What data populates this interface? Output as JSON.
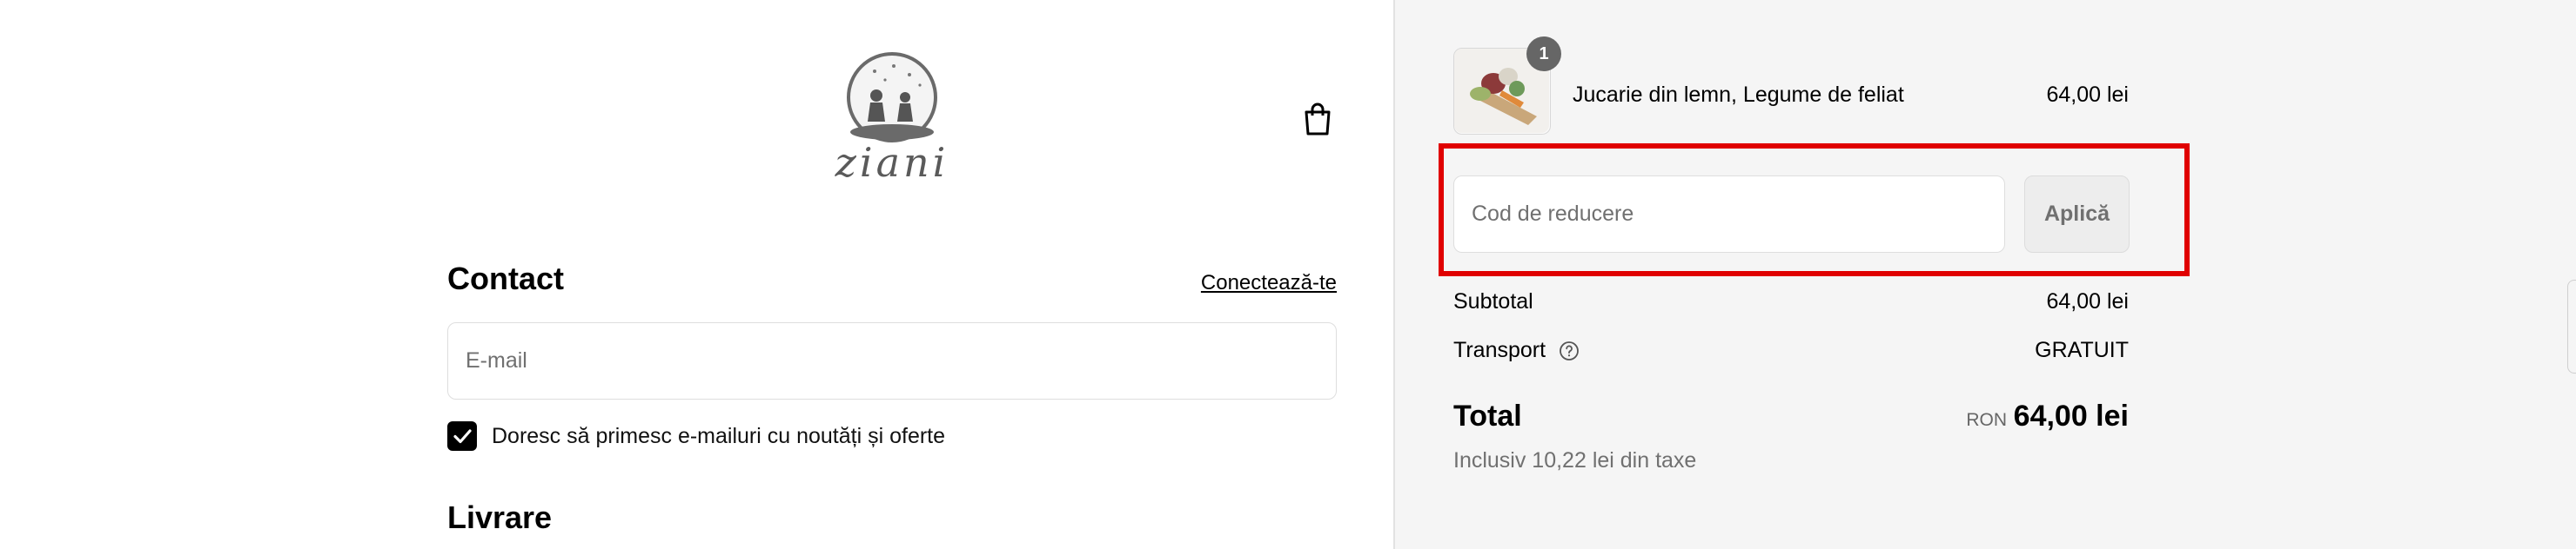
{
  "header": {
    "brand": "ziani",
    "icons": {
      "logo": "ziani-logo-icon",
      "cart": "shopping-bag-icon"
    }
  },
  "contact": {
    "title": "Contact",
    "login_link": "Conectează-te",
    "email_placeholder": "E-mail",
    "email_value": "",
    "newsletter_checked": true,
    "newsletter_label": "Doresc să primesc e-mailuri cu noutăți și oferte"
  },
  "shipping": {
    "title": "Livrare"
  },
  "order_summary": {
    "item": {
      "quantity": "1",
      "name": "Jucarie din lemn, Legume de feliat",
      "price": "64,00 lei"
    },
    "discount": {
      "placeholder": "Cod de reducere",
      "value": "",
      "apply_label": "Aplică"
    },
    "subtotal": {
      "label": "Subtotal",
      "value": "64,00 lei"
    },
    "transport": {
      "label": "Transport",
      "value": "GRATUIT"
    },
    "total": {
      "label": "Total",
      "currency": "RON",
      "value": "64,00 lei"
    },
    "tax_note": "Inclusiv 10,22 lei din taxe"
  },
  "colors": {
    "highlight": "#e00000",
    "summary_bg": "#f5f5f5",
    "badge": "#666666"
  }
}
